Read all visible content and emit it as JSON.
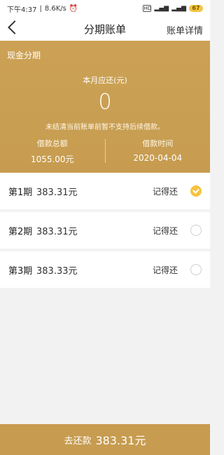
{
  "status": {
    "time": "下午4:37",
    "speed": "8.6K/s",
    "battery": "67"
  },
  "header": {
    "title": "分期账单",
    "right_label": "账单详情"
  },
  "summary": {
    "tag": "现金分期",
    "month_label": "本月应还(元)",
    "month_amount": "0",
    "note": "未结清当前账单前暂不支持后续借款。",
    "loan_total_label": "借款总额",
    "loan_total_value": "1055.00元",
    "loan_time_label": "借款时间",
    "loan_time_value": "2020-04-04"
  },
  "installments": [
    {
      "term": "第1期",
      "amount": "383.31元",
      "remind": "记得还",
      "checked": true
    },
    {
      "term": "第2期",
      "amount": "383.31元",
      "remind": "记得还",
      "checked": false
    },
    {
      "term": "第3期",
      "amount": "383.33元",
      "remind": "记得还",
      "checked": false
    }
  ],
  "footer": {
    "label": "去还款",
    "amount": "383.31元"
  },
  "colors": {
    "gold": "#c79c50",
    "check": "#f5c341"
  }
}
